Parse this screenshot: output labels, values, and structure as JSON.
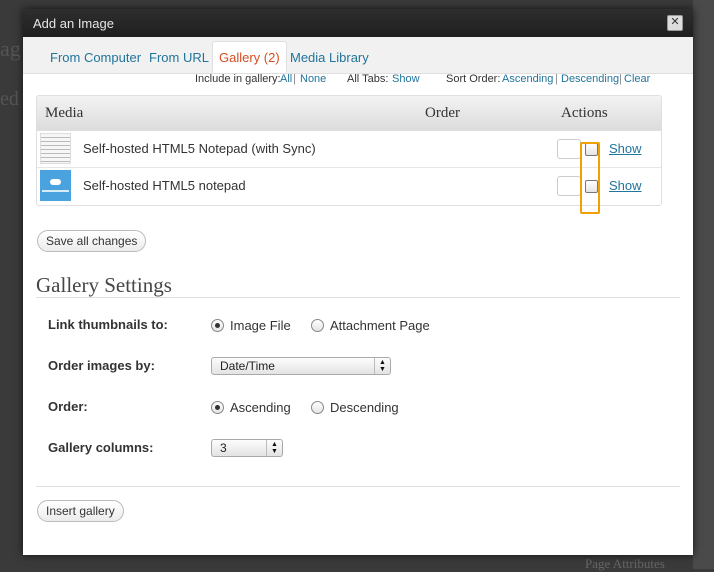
{
  "dialog": {
    "title": "Add an Image",
    "close_glyph": "✕"
  },
  "tabs": [
    {
      "label": "From Computer"
    },
    {
      "label": "From URL"
    },
    {
      "label": "Gallery (2)"
    },
    {
      "label": "Media Library"
    }
  ],
  "filter": {
    "include_label": "Include in gallery:",
    "all": "All",
    "none": "None",
    "alltabs_label": "All Tabs:",
    "show": "Show",
    "sort_label": "Sort Order:",
    "ascending": "Ascending",
    "descending": "Descending",
    "clear": "Clear",
    "sep": "|"
  },
  "table": {
    "headers": {
      "media": "Media",
      "order": "Order",
      "actions": "Actions"
    },
    "rows": [
      {
        "title": "Self-hosted HTML5 Notepad (with Sync)",
        "action": "Show",
        "thumb_icon": "notepad-thumbnail"
      },
      {
        "title": "Self-hosted HTML5 notepad",
        "action": "Show",
        "thumb_icon": "cloud-thumbnail"
      }
    ]
  },
  "save_button": "Save all changes",
  "gallery_settings": {
    "title": "Gallery Settings",
    "link_label": "Link thumbnails to:",
    "link_options": [
      "Image File",
      "Attachment Page"
    ],
    "link_selected": "Image File",
    "orderby_label": "Order images by:",
    "orderby_value": "Date/Time",
    "order_label": "Order:",
    "order_options": [
      "Ascending",
      "Descending"
    ],
    "order_selected": "Ascending",
    "columns_label": "Gallery columns:",
    "columns_value": "3"
  },
  "insert_button": "Insert gallery",
  "colors": {
    "link": "#21759b",
    "active_tab": "#d54e21",
    "highlight": "#f0a000"
  },
  "background": {
    "fragment_1": "ag",
    "fragment_2": "ed",
    "fragment_3": "Page Attributes"
  }
}
